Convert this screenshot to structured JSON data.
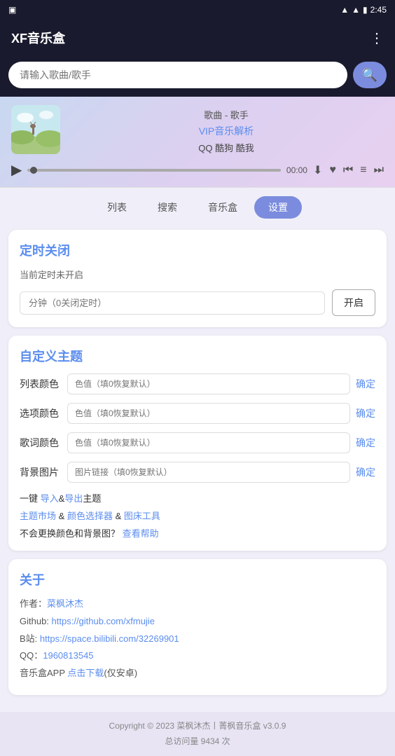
{
  "statusBar": {
    "leftIcon": "android-icon",
    "time": "2:45",
    "batteryIcon": "battery-icon",
    "wifiIcon": "wifi-icon",
    "signalIcon": "signal-icon"
  },
  "topBar": {
    "title": "XF音乐盒",
    "moreIcon": "⋮"
  },
  "search": {
    "placeholder": "请输入歌曲/歌手",
    "searchIcon": "🔍"
  },
  "player": {
    "songInfo": "歌曲 - 歌手",
    "vipText": "VIP音乐解析",
    "sources": "QQ 酷狗 酷我",
    "time": "00:00"
  },
  "tabs": [
    {
      "id": "list",
      "label": "列表",
      "active": false
    },
    {
      "id": "search",
      "label": "搜索",
      "active": false
    },
    {
      "id": "musicbox",
      "label": "音乐盒",
      "active": false
    },
    {
      "id": "settings",
      "label": "设置",
      "active": true
    }
  ],
  "timerCard": {
    "title": "定时关闭",
    "status": "当前定时未开启",
    "inputPlaceholder": "分钟（0关闭定时）",
    "enableBtn": "开启"
  },
  "themeCard": {
    "title": "自定义主题",
    "rows": [
      {
        "label": "列表颜色",
        "placeholder": "色值（填0恢复默认）",
        "confirm": "确定"
      },
      {
        "label": "选项颜色",
        "placeholder": "色值（填0恢复默认）",
        "confirm": "确定"
      },
      {
        "label": "歌词颜色",
        "placeholder": "色值（填0恢复默认）",
        "confirm": "确定"
      },
      {
        "label": "背景图片",
        "placeholder": "图片链接（填0恢复默认）",
        "confirm": "确定"
      }
    ],
    "importExportPrefix": "一键 ",
    "importText": "导入",
    "andText": "&",
    "exportText": "导出",
    "importExportSuffix": "主题",
    "marketText": "主题市场",
    "colorPickerText": "颜色选择器",
    "colorToolText": "图床工具",
    "noChangeHintPrefix": "不会更换颜色和背景图？",
    "helpText": "查看帮助"
  },
  "aboutCard": {
    "title": "关于",
    "author": "作者：菜枫沐杰",
    "authorLink": "菜枫沐杰",
    "githubPrefix": "Github: ",
    "githubUrl": "https://github.com/xfmujie",
    "bilibiliPrefix": "B站: ",
    "bilibiliUrl": "https://space.bilibili.com/32269901",
    "qqPrefix": "QQ：",
    "qqNumber": "1960813545",
    "appPrefix": "音乐盒APP ",
    "downloadText": "点击下载",
    "downloadSuffix": "(仅安卓)"
  },
  "footer": {
    "copyright": "Copyright © 2023 菜枫沐杰丨菁枫音乐盒 v3.0.9",
    "visits": "总访问量 9434 次"
  }
}
